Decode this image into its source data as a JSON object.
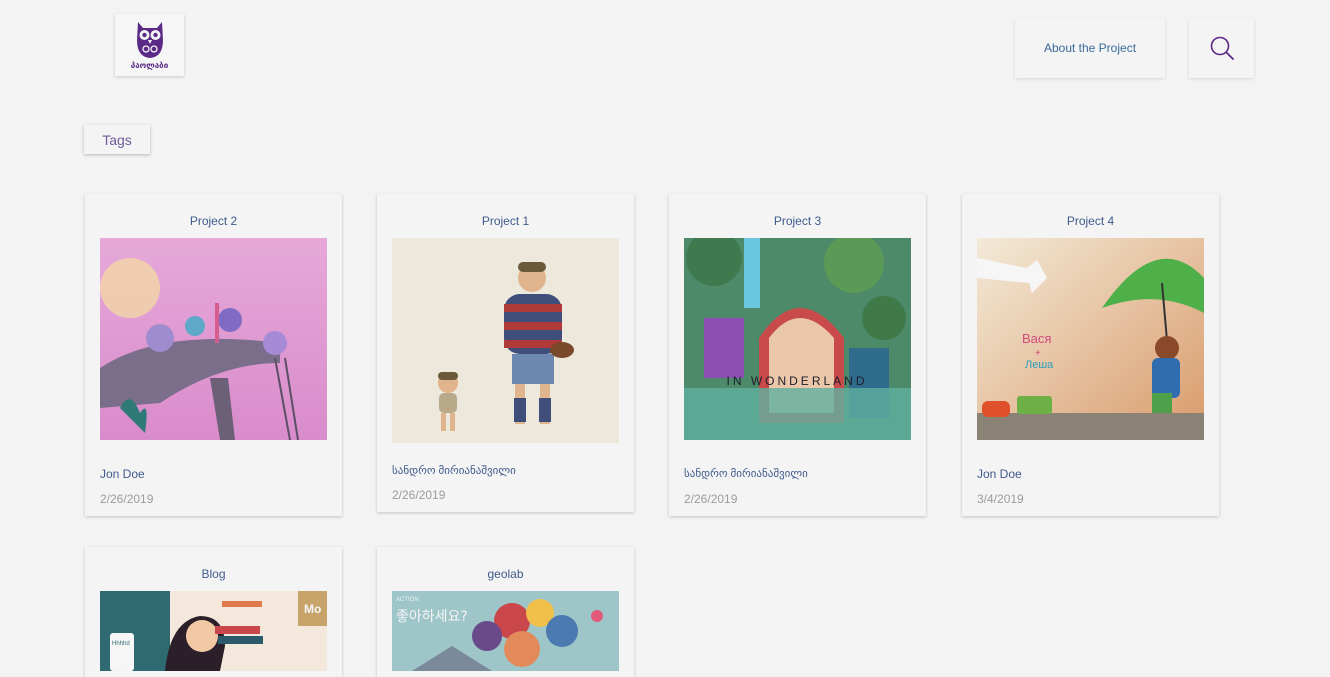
{
  "header": {
    "logo_text": "პაოლაბი",
    "about_label": "About the Project"
  },
  "filters": {
    "tags_label": "Tags"
  },
  "projects": [
    {
      "title": "Project 2",
      "author": "Jon Doe",
      "date": "2/26/2019"
    },
    {
      "title": "Project 1",
      "author": "სანდრო მირიანაშვილი",
      "date": "2/26/2019"
    },
    {
      "title": "Project 3",
      "author": "სანდრო მირიანაშვილი",
      "date": "2/26/2019",
      "image_text": "IN WONDERLAND"
    },
    {
      "title": "Project 4",
      "author": "Jon Doe",
      "date": "3/4/2019",
      "image_text": [
        "Вася",
        "+",
        "Леша"
      ]
    },
    {
      "title": "Blog",
      "image_text": [
        "Mo",
        "Hhhhd"
      ]
    },
    {
      "title": "geolab",
      "image_text": [
        "좋아하세요?",
        "ACTION"
      ]
    }
  ],
  "colors": {
    "accent": "#5b2a86",
    "link": "#3f5a8c",
    "date": "#9b9b9b",
    "background": "#f3f3f3"
  }
}
